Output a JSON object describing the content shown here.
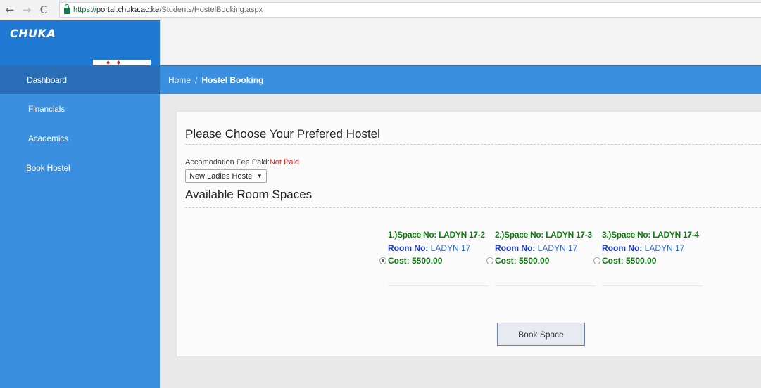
{
  "browser": {
    "back": "←",
    "forward": "→",
    "reload": "C",
    "url_secure": "https://",
    "url_host": "portal.chuka.ac.ke",
    "url_path": "/Students/HostelBooking.aspx"
  },
  "brand": {
    "name": "CHUKA"
  },
  "sidebar": {
    "items": [
      {
        "label": "Dashboard",
        "active": true
      },
      {
        "label": "Financials"
      },
      {
        "label": "Academics"
      },
      {
        "label": "Book Hostel"
      }
    ]
  },
  "breadcrumb": {
    "home": "Home",
    "separator": "/",
    "current": "Hostel Booking"
  },
  "card": {
    "title": "Please Choose Your Prefered Hostel",
    "fee_label": "Accomodation Fee Paid:",
    "fee_status": "Not Paid",
    "hostel_select": {
      "selected": "New Ladies Hostel"
    },
    "section_title": "Available Room Spaces"
  },
  "spaces": [
    {
      "space_no": "1.)Space No: LADYN 17-2",
      "room_label": "Room No:",
      "room_value": "LADYN 17",
      "cost": "Cost: 5500.00",
      "selected": true
    },
    {
      "space_no": "2.)Space No: LADYN 17-3",
      "room_label": "Room No:",
      "room_value": "LADYN 17",
      "cost": "Cost: 5500.00",
      "selected": false
    },
    {
      "space_no": "3.)Space No: LADYN 17-4",
      "room_label": "Room No:",
      "room_value": "LADYN 17",
      "cost": "Cost: 5500.00",
      "selected": false
    }
  ],
  "actions": {
    "book_label": "Book Space"
  },
  "colors": {
    "sidebar": "#3b8fe0",
    "active_nav": "#2a6eb7",
    "status_red": "#e0201c",
    "green": "#0d7b0d",
    "blue": "#1b39d1"
  }
}
